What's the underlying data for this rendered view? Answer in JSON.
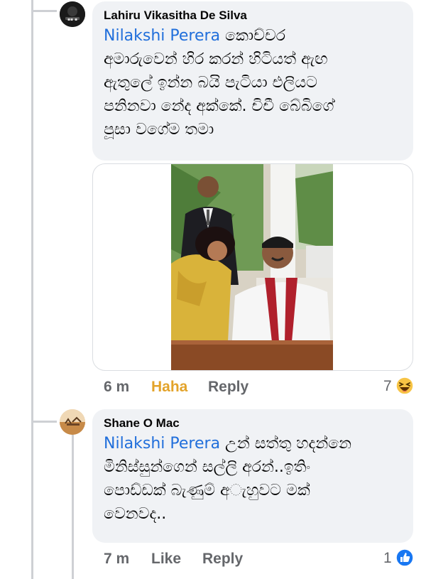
{
  "comments": [
    {
      "author": "Lahiru Vikasitha De Silva",
      "mention": "Nilakshi Perera",
      "text_lines": [
        " කොච්චර",
        "අමාරුවෙන් හිර කරන්  හිටියත් ඇඟ",
        "ඇතුලේ ඉන්න බයි පැටියා එලියට",
        "පනිනවා නේද අක්කේ. චිචී බේබිගේ",
        "පූසා වගේම තමා"
      ],
      "time": "6 m",
      "reaction_label": "Haha",
      "reply_label": "Reply",
      "reaction_count": "7",
      "reaction_icon": "haha-emoji-icon",
      "reaction_color": "#e3a32a"
    },
    {
      "author": "Shane O Mac",
      "mention": "Nilakshi Perera",
      "text_lines": [
        " උන් සත්තු හදන්නෙ",
        "මිනිස්සුන්ගෙන් සල්ලි අරන්..ඉතිං",
        "පොඩ්ඩක් බැණුම් අැහුවට මක්",
        "වෙනවද.."
      ],
      "time": "7 m",
      "reaction_label": "Like",
      "reply_label": "Reply",
      "reaction_count": "1",
      "reaction_icon": "like-thumb-icon",
      "reaction_color": "#1877f2"
    }
  ],
  "colors": {
    "bubble_bg": "#f0f2f5",
    "mention": "#216fdb",
    "meta": "#65676b",
    "haha": "#e3a32a"
  }
}
